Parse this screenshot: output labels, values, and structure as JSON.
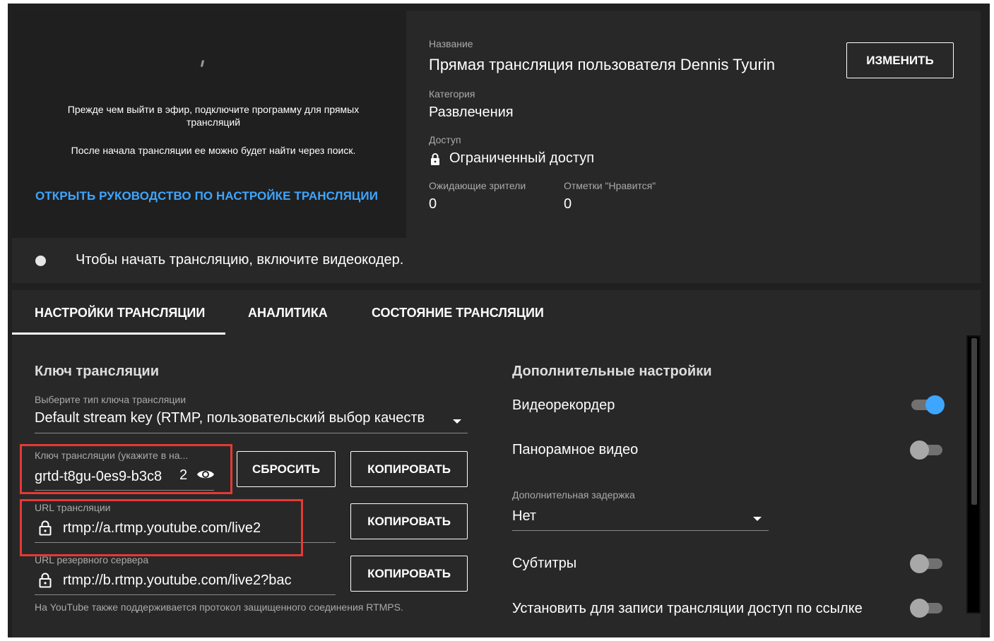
{
  "preview": {
    "line1": "Прежде чем выйти в эфир, подключите программу для прямых трансляций",
    "line2": "После начала трансляции ее можно будет найти через поиск.",
    "guide_link": "ОТКРЫТЬ РУКОВОДСТВО ПО НАСТРОЙКЕ ТРАНСЛЯЦИИ"
  },
  "info": {
    "title_label": "Название",
    "title_value": "Прямая трансляция пользователя Dennis Tyurin",
    "edit_label": "ИЗМЕНИТЬ",
    "category_label": "Категория",
    "category_value": "Развлечения",
    "access_label": "Доступ",
    "access_value": "Ограниченный доступ",
    "viewers_label": "Ожидающие зрители",
    "viewers_value": "0",
    "likes_label": "Отметки \"Нравится\"",
    "likes_value": "0"
  },
  "status": {
    "text": "Чтобы начать трансляцию, включите видеокодер."
  },
  "tabs": [
    {
      "label": "НАСТРОЙКИ ТРАНСЛЯЦИИ",
      "active": true
    },
    {
      "label": "АНАЛИТИКА",
      "active": false
    },
    {
      "label": "СОСТОЯНИЕ ТРАНСЛЯЦИИ",
      "active": false
    }
  ],
  "stream_key": {
    "heading": "Ключ трансляции",
    "type_label": "Выберите тип ключа трансляции",
    "type_value": "Default stream key (RTMP, пользовательский выбор качеств",
    "key_label": "Ключ трансляции (укажите в на...",
    "key_value": "grtd-t8gu-0es9-b3c8",
    "key_suffix": "2",
    "reset_label": "СБРОСИТЬ",
    "copy_label": "КОПИРОВАТЬ",
    "url_label": "URL трансляции",
    "url_value": "rtmp://a.rtmp.youtube.com/live2",
    "backup_label": "URL резервного сервера",
    "backup_value": "rtmp://b.rtmp.youtube.com/live2?bac",
    "rtmps_note": "На YouTube также поддерживается протокол защищенного соединения RTMPS."
  },
  "additional": {
    "heading": "Дополнительные настройки",
    "dvr_label": "Видеорекордер",
    "dvr_on": true,
    "panorama_label": "Панорамное видео",
    "panorama_on": false,
    "latency_label": "Дополнительная задержка",
    "latency_value": "Нет",
    "subtitles_label": "Субтитры",
    "subtitles_on": false,
    "unlisted_label": "Установить для записи трансляции доступ по ссылке",
    "unlisted_on": false
  },
  "colors": {
    "accent": "#3ea6ff",
    "highlight_box": "#e53935",
    "panel": "#282828",
    "background": "#1f1f1f"
  }
}
